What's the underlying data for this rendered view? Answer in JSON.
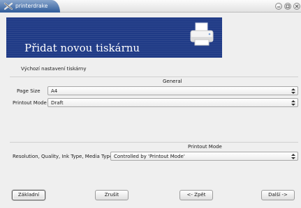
{
  "window": {
    "title": "printerdrake"
  },
  "banner": {
    "title": "Přidat novou tiskárnu"
  },
  "subtitle": "Výchozí nastavení tiskárny",
  "general": {
    "heading": "General",
    "page_size": {
      "label": "Page Size",
      "value": "A4"
    },
    "printout_mode": {
      "label": "Printout Mode",
      "value": "Draft"
    }
  },
  "printout_mode_section": {
    "heading": "Printout Mode",
    "resolution": {
      "label": "Resolution, Quality, Ink Type, Media Type",
      "value": "Controlled by 'Printout Mode'"
    }
  },
  "buttons": {
    "advanced": "Základní",
    "cancel": "Zrušit",
    "back": "<- Zpět",
    "next": "Další ->"
  },
  "colors": {
    "banner": "#1f3a86",
    "titlebar_tab": "#2f5c9a"
  }
}
